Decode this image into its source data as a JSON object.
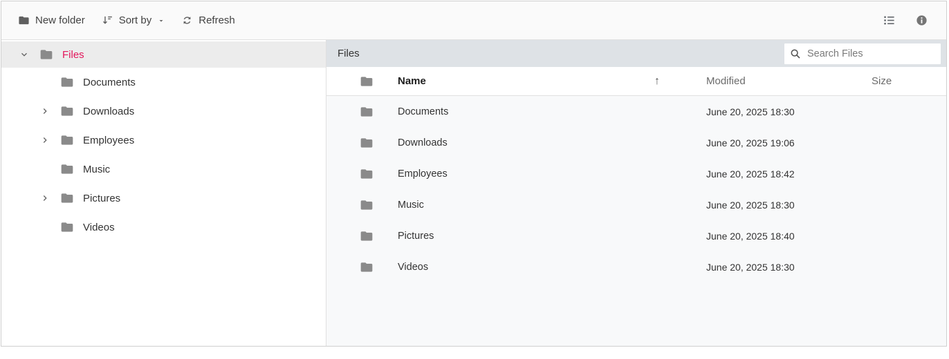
{
  "toolbar": {
    "new_folder_label": "New folder",
    "sort_by_label": "Sort by",
    "refresh_label": "Refresh",
    "icons": [
      "folder-icon",
      "sort-icon",
      "caret-down-icon",
      "refresh-icon",
      "details-view-icon",
      "info-icon"
    ]
  },
  "sidebar": {
    "root": {
      "label": "Files",
      "expanded": true,
      "selected": true
    },
    "items": [
      {
        "label": "Documents",
        "has_children": false
      },
      {
        "label": "Downloads",
        "has_children": true
      },
      {
        "label": "Employees",
        "has_children": true
      },
      {
        "label": "Music",
        "has_children": false
      },
      {
        "label": "Pictures",
        "has_children": true
      },
      {
        "label": "Videos",
        "has_children": false
      }
    ]
  },
  "breadcrumb": {
    "path": "Files"
  },
  "search": {
    "placeholder": "Search Files",
    "value": ""
  },
  "grid": {
    "columns": {
      "name": "Name",
      "modified": "Modified",
      "size": "Size"
    },
    "sort": {
      "column": "Name",
      "direction": "ascending",
      "arrow": "↑"
    },
    "rows": [
      {
        "name": "Documents",
        "modified": "June 20, 2025 18:30",
        "size": ""
      },
      {
        "name": "Downloads",
        "modified": "June 20, 2025 19:06",
        "size": ""
      },
      {
        "name": "Employees",
        "modified": "June 20, 2025 18:42",
        "size": ""
      },
      {
        "name": "Music",
        "modified": "June 20, 2025 18:30",
        "size": ""
      },
      {
        "name": "Pictures",
        "modified": "June 20, 2025 18:40",
        "size": ""
      },
      {
        "name": "Videos",
        "modified": "June 20, 2025 18:30",
        "size": ""
      }
    ]
  },
  "colors": {
    "accent": "#e3165b",
    "folder_icon": "#8a8a8a",
    "toolbar_icon": "#5f5f5f",
    "breadcrumb_bg": "#dee2e6",
    "grid_body_bg": "#f8f9fa"
  }
}
